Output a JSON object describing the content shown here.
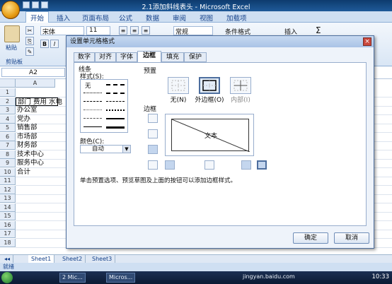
{
  "window": {
    "title": "2.1添加斜线表头 - Microsoft Excel"
  },
  "ribbon": {
    "tabs": [
      "开始",
      "插入",
      "页面布局",
      "公式",
      "数据",
      "审阅",
      "视图",
      "加载项"
    ],
    "paste_label": "粘贴",
    "clipboard_label": "剪贴板",
    "font_name": "宋体",
    "font_size": "11",
    "number_format": "常规",
    "conditional_format": "条件格式",
    "insert_label": "插入",
    "sigma_label": "Σ"
  },
  "namebox": {
    "value": "A2"
  },
  "sheet": {
    "col_a": "A",
    "rows": [
      {
        "num": "1",
        "text": ""
      },
      {
        "num": "2",
        "text": "部门  费用 水电"
      },
      {
        "num": "3",
        "text": "办公室"
      },
      {
        "num": "4",
        "text": "党办"
      },
      {
        "num": "5",
        "text": "销售部"
      },
      {
        "num": "6",
        "text": "市场部"
      },
      {
        "num": "7",
        "text": "财务部"
      },
      {
        "num": "8",
        "text": "技术中心"
      },
      {
        "num": "9",
        "text": "服务中心"
      },
      {
        "num": "10",
        "text": "合计"
      },
      {
        "num": "11",
        "text": ""
      },
      {
        "num": "12",
        "text": ""
      },
      {
        "num": "13",
        "text": ""
      },
      {
        "num": "14",
        "text": ""
      },
      {
        "num": "15",
        "text": ""
      },
      {
        "num": "16",
        "text": ""
      },
      {
        "num": "17",
        "text": ""
      },
      {
        "num": "18",
        "text": ""
      }
    ],
    "sheet_tabs": [
      "Sheet1",
      "Sheet2",
      "Sheet3"
    ]
  },
  "status": {
    "text": "就绪"
  },
  "taskbar": {
    "items": [
      "2 Mic...",
      "Micros...",
      "jingyan.baidu.com"
    ],
    "clock": "10:33"
  },
  "dialog": {
    "title": "设置单元格格式",
    "tabs": [
      "数字",
      "对齐",
      "字体",
      "边框",
      "填充",
      "保护"
    ],
    "active_tab": "边框",
    "line_section": "线条",
    "style_label": "样式(S):",
    "none_label": "无",
    "color_label": "颜色(C):",
    "color_value": "自动",
    "presets_label": "预置",
    "preset_none": "无(N)",
    "preset_outline": "外边框(O)",
    "preset_inside": "内部(I)",
    "border_label": "边框",
    "preview_text": "文本",
    "hint": "单击预置选项、预览草图及上面的按钮可以添加边框样式。",
    "ok": "确定",
    "cancel": "取消"
  }
}
